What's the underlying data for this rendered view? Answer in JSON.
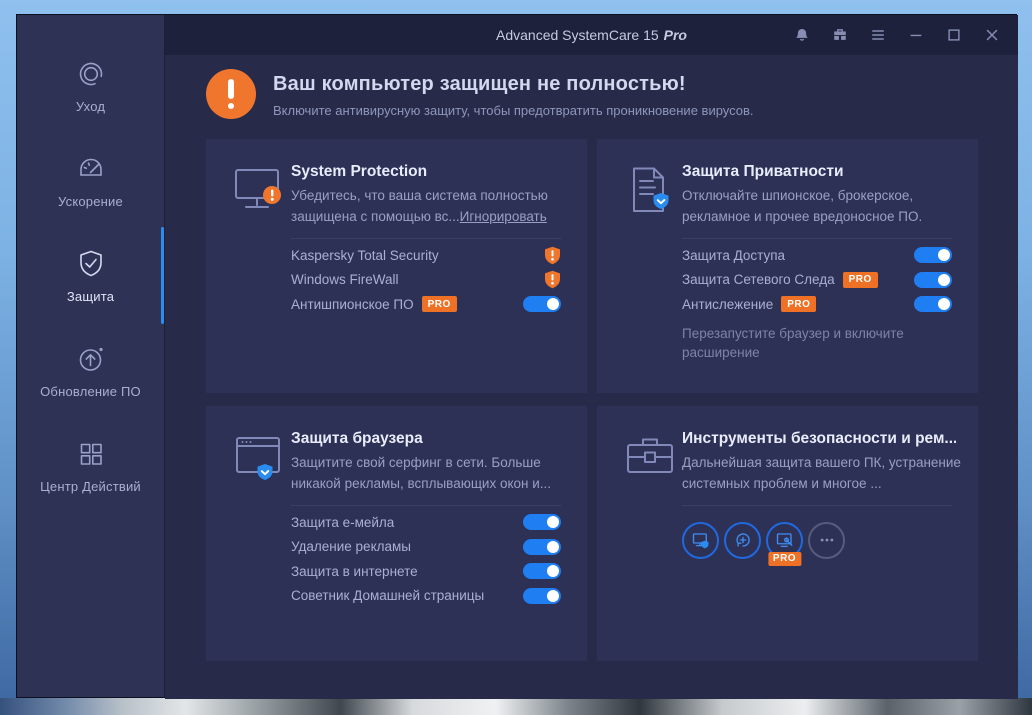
{
  "window": {
    "title": "Advanced SystemCare 15",
    "title_pro": "Pro"
  },
  "sidebar": {
    "items": [
      {
        "label": "Уход"
      },
      {
        "label": "Ускорение"
      },
      {
        "label": "Защита",
        "active": true
      },
      {
        "label": "Обновление ПО"
      },
      {
        "label": "Центр Действий"
      }
    ]
  },
  "header": {
    "title": "Ваш компьютер защищен не полностью!",
    "subtitle": "Включите антивирусную защиту, чтобы предотвратить проникновение вирусов."
  },
  "badges": {
    "pro": "PRO"
  },
  "cards": [
    {
      "title": "System Protection",
      "desc": "Убедитесь, что ваша система полностью защищена с помощью вс...",
      "link": "Игнорировать",
      "rows": [
        {
          "label": "Kaspersky Total Security",
          "control": "warning"
        },
        {
          "label": "Windows FireWall",
          "control": "warning"
        },
        {
          "label": "Антишпионское ПО",
          "pro": true,
          "control": "toggle-on"
        }
      ]
    },
    {
      "title": "Защита Приватности",
      "desc": "Отключайте шпионское, брокерское, рекламное и прочее вредоносное ПО.",
      "rows": [
        {
          "label": "Защита Доступа",
          "control": "toggle-on"
        },
        {
          "label": "Защита Сетевого Следа",
          "pro": true,
          "control": "toggle-on"
        },
        {
          "label": "Антислежение",
          "pro": true,
          "control": "toggle-on"
        }
      ],
      "note": "Перезапустите браузер и включите расширение"
    },
    {
      "title": "Защита браузера",
      "desc": "Защитите свой серфинг в сети. Больше никакой рекламы, всплывающих окон и...",
      "rows": [
        {
          "label": "Защита e-мейла",
          "control": "toggle-on"
        },
        {
          "label": "Удаление рекламы",
          "control": "toggle-on"
        },
        {
          "label": "Защита в интернете",
          "control": "toggle-on"
        },
        {
          "label": "Советник Домашней страницы",
          "control": "toggle-on"
        }
      ]
    },
    {
      "title": "Инструменты безопасности и рем...",
      "desc": "Дальнейшая защита вашего ПК, устранение системных проблем и многое ...",
      "tools": [
        {
          "name": "pc-security"
        },
        {
          "name": "restore"
        },
        {
          "name": "repair",
          "pro": true
        },
        {
          "name": "more"
        }
      ]
    }
  ],
  "colors": {
    "accent_blue": "#1f7ef2",
    "warning_orange": "#f0762e",
    "pro_badge": "#ef7126",
    "card_bg": "#2d3155",
    "main_bg": "#272b49",
    "sidebar_bg": "#2e3255",
    "titlebar_bg": "#1d213b"
  }
}
